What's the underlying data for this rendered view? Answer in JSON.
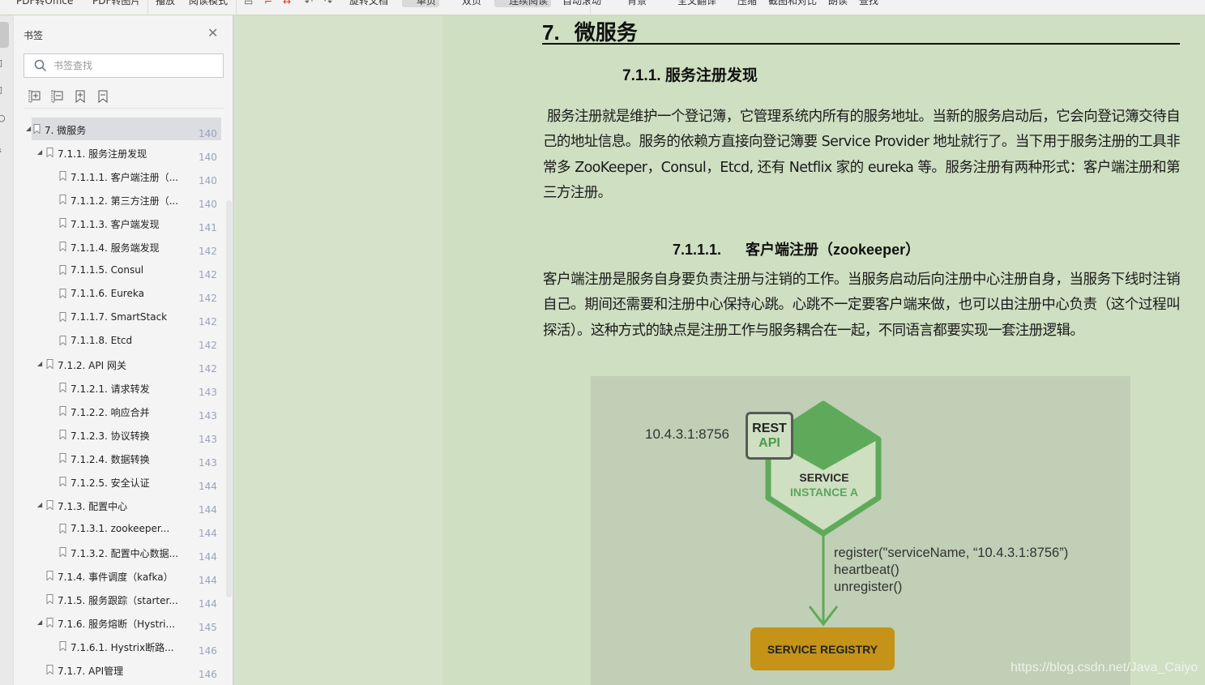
{
  "toolbar": {
    "items": [
      "PDF转Office",
      "PDF转图片",
      "播放",
      "阅读模式",
      "旋转文档",
      "单页",
      "双页",
      "连续阅读",
      "自动滚动",
      "背景",
      "全文翻译",
      "压缩",
      "截图和对比",
      "朗读",
      "查找"
    ],
    "active": [
      "单页",
      "连续阅读"
    ]
  },
  "sidebar": {
    "title": "书签",
    "search_placeholder": "书签查找",
    "tools": [
      "expand-all-icon",
      "collapse-all-icon",
      "add-bookmark-icon",
      "remove-bookmark-icon"
    ],
    "items": [
      {
        "label": "7.   微服务",
        "page": "140",
        "level": 0,
        "expanded": true,
        "selected": true
      },
      {
        "label": "7.1.1. 服务注册发现",
        "page": "140",
        "level": 1,
        "expanded": true
      },
      {
        "label": "7.1.1.1. 客户端注册（...",
        "page": "140",
        "level": 2
      },
      {
        "label": "7.1.1.2. 第三方注册（...",
        "page": "140",
        "level": 2
      },
      {
        "label": "7.1.1.3. 客户端发现",
        "page": "141",
        "level": 2
      },
      {
        "label": "7.1.1.4. 服务端发现",
        "page": "142",
        "level": 2
      },
      {
        "label": "7.1.1.5. Consul",
        "page": "142",
        "level": 2
      },
      {
        "label": "7.1.1.6. Eureka",
        "page": "142",
        "level": 2
      },
      {
        "label": "7.1.1.7. SmartStack",
        "page": "142",
        "level": 2
      },
      {
        "label": "7.1.1.8. Etcd",
        "page": "142",
        "level": 2
      },
      {
        "label": "7.1.2. API 网关",
        "page": "142",
        "level": 1,
        "expanded": true
      },
      {
        "label": "7.1.2.1. 请求转发",
        "page": "143",
        "level": 2
      },
      {
        "label": "7.1.2.2. 响应合并",
        "page": "143",
        "level": 2
      },
      {
        "label": "7.1.2.3. 协议转换",
        "page": "143",
        "level": 2
      },
      {
        "label": "7.1.2.4. 数据转换",
        "page": "143",
        "level": 2
      },
      {
        "label": "7.1.2.5. 安全认证",
        "page": "144",
        "level": 2
      },
      {
        "label": "7.1.3. 配置中心",
        "page": "144",
        "level": 1,
        "expanded": true
      },
      {
        "label": "7.1.3.1. zookeeper...",
        "page": "144",
        "level": 2
      },
      {
        "label": "7.1.3.2. 配置中心数据...",
        "page": "144",
        "level": 2
      },
      {
        "label": "7.1.4. 事件调度（kafka）",
        "page": "144",
        "level": 1
      },
      {
        "label": "7.1.5. 服务跟踪（starter...",
        "page": "144",
        "level": 1
      },
      {
        "label": "7.1.6. 服务熔断（Hystri...",
        "page": "145",
        "level": 1,
        "expanded": true
      },
      {
        "label": "7.1.6.1. Hystrix断路...",
        "page": "146",
        "level": 2
      },
      {
        "label": "7.1.7. API管理",
        "page": "146",
        "level": 1
      }
    ]
  },
  "document": {
    "h1_num": "7.",
    "h1_text": "微服务",
    "h2": "7.1.1.  服务注册发现",
    "p1": "服务注册就是维护一个登记簿，它管理系统内所有的服务地址。当新的服务启动后，它会向登记簿交待自己的地址信息。服务的依赖方直接向登记簿要 Service Provider 地址就行了。当下用于服务注册的工具非常多 ZooKeeper，Consul，Etcd, 还有 Netflix 家的 eureka 等。服务注册有两种形式：客户端注册和第三方注册。",
    "h4_num": "7.1.1.1.",
    "h4_text": "客户端注册（zookeeper）",
    "p2": "客户端注册是服务自身要负责注册与注销的工作。当服务启动后向注册中心注册自身，当服务下线时注销自己。期间还需要和注册中心保持心跳。心跳不一定要客户端来做，也可以由注册中心负责（这个过程叫探活）。这种方式的缺点是注册工作与服务耦合在一起，不同语言都要实现一套注册逻辑。",
    "figure": {
      "address": "10.4.3.1:8756",
      "rest_line1": "REST",
      "rest_line2": "API",
      "service_line1": "SERVICE",
      "service_line2": "INSTANCE A",
      "call1": "register(\"serviceName, “10.4.3.1:8756”)",
      "call2": "heartbeat()",
      "call3": "unregister()",
      "registry": "SERVICE REGISTRY"
    },
    "watermark": "https://blog.csdn.net/Java_Caiyo"
  },
  "colors": {
    "eye_protection_bg": "#d4e3c9",
    "page_bg": "#cfdfc2",
    "hex_green": "#5faa5a",
    "registry_gold": "#c49317"
  }
}
